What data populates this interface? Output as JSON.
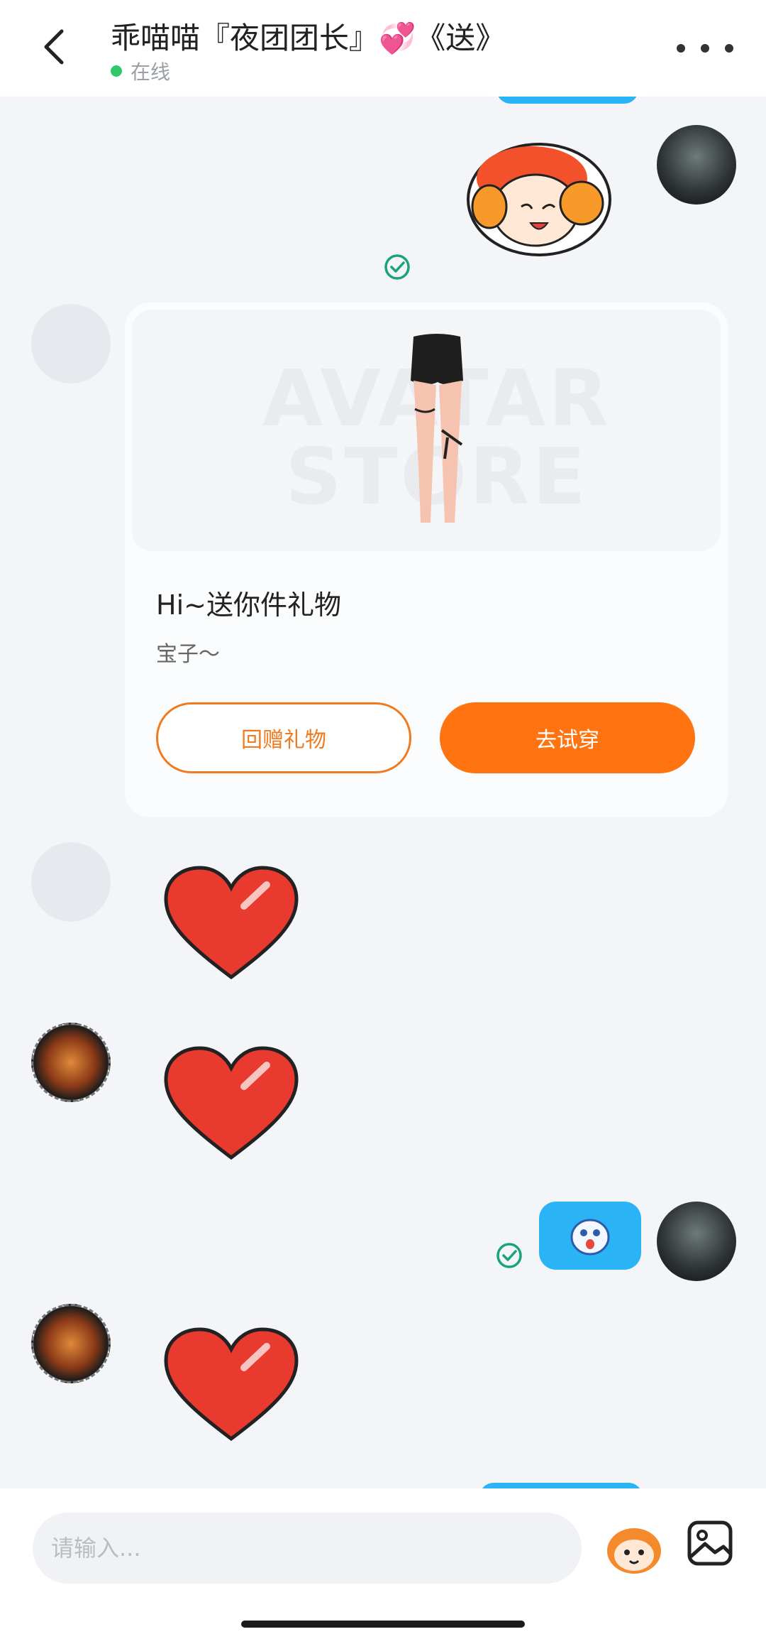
{
  "header": {
    "title": "乖喵喵『夜团团长』💞《送》",
    "status": "在线"
  },
  "gift_card": {
    "image_watermark": "AVATAR STORE",
    "title": "Hi~送你件礼物",
    "subtitle": "宝子～",
    "return_gift_label": "回赠礼物",
    "try_on_label": "去试穿"
  },
  "input": {
    "placeholder": "请输入..."
  },
  "colors": {
    "accent": "#ff7310",
    "bubble": "#2bb4f5",
    "online": "#2fc76a",
    "read_check": "#1aa37a"
  },
  "icons": [
    "back-icon",
    "more-icon",
    "check-icon",
    "heart-sticker",
    "mascot-icon",
    "image-icon"
  ]
}
